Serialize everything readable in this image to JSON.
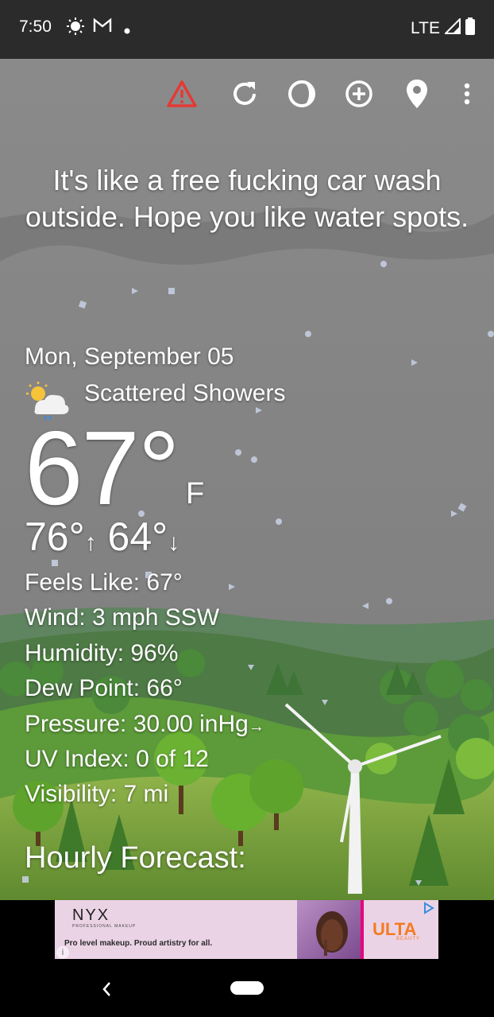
{
  "status_bar": {
    "time": "7:50",
    "network": "LTE"
  },
  "toolbar": {
    "icons": [
      "warning-icon",
      "refresh-icon",
      "theme-icon",
      "add-location-icon",
      "location-pin-icon",
      "more-vert-icon"
    ]
  },
  "quote": "It's like a free fucking car wash outside. Hope you like water spots.",
  "weather": {
    "date": "Mon, September 05",
    "condition": "Scattered Showers",
    "temperature": "67°",
    "unit": "F",
    "high": "76°",
    "low": "64°",
    "details": [
      {
        "label": "Feels Like:",
        "value": "67°"
      },
      {
        "label": "Wind:",
        "value": "3 mph SSW"
      },
      {
        "label": "Humidity:",
        "value": "96%"
      },
      {
        "label": "Dew Point:",
        "value": "66°"
      },
      {
        "label": "Pressure:",
        "value": "30.00 inHg"
      },
      {
        "label": "UV Index:",
        "value": "0 of 12"
      },
      {
        "label": "Visibility:",
        "value": "7 mi"
      }
    ],
    "hourly_title": "Hourly Forecast:"
  },
  "ad": {
    "brand": "NYX",
    "brand_sub": "PROFESSIONAL MAKEUP",
    "tagline": "Pro level makeup. Proud artistry for all.",
    "partner": "ULTA",
    "partner_sub": "BEAUTY"
  },
  "colors": {
    "alert_red": "#e53935",
    "ad_bg": "#ebd3e6",
    "ulta_orange": "#f47b20"
  }
}
